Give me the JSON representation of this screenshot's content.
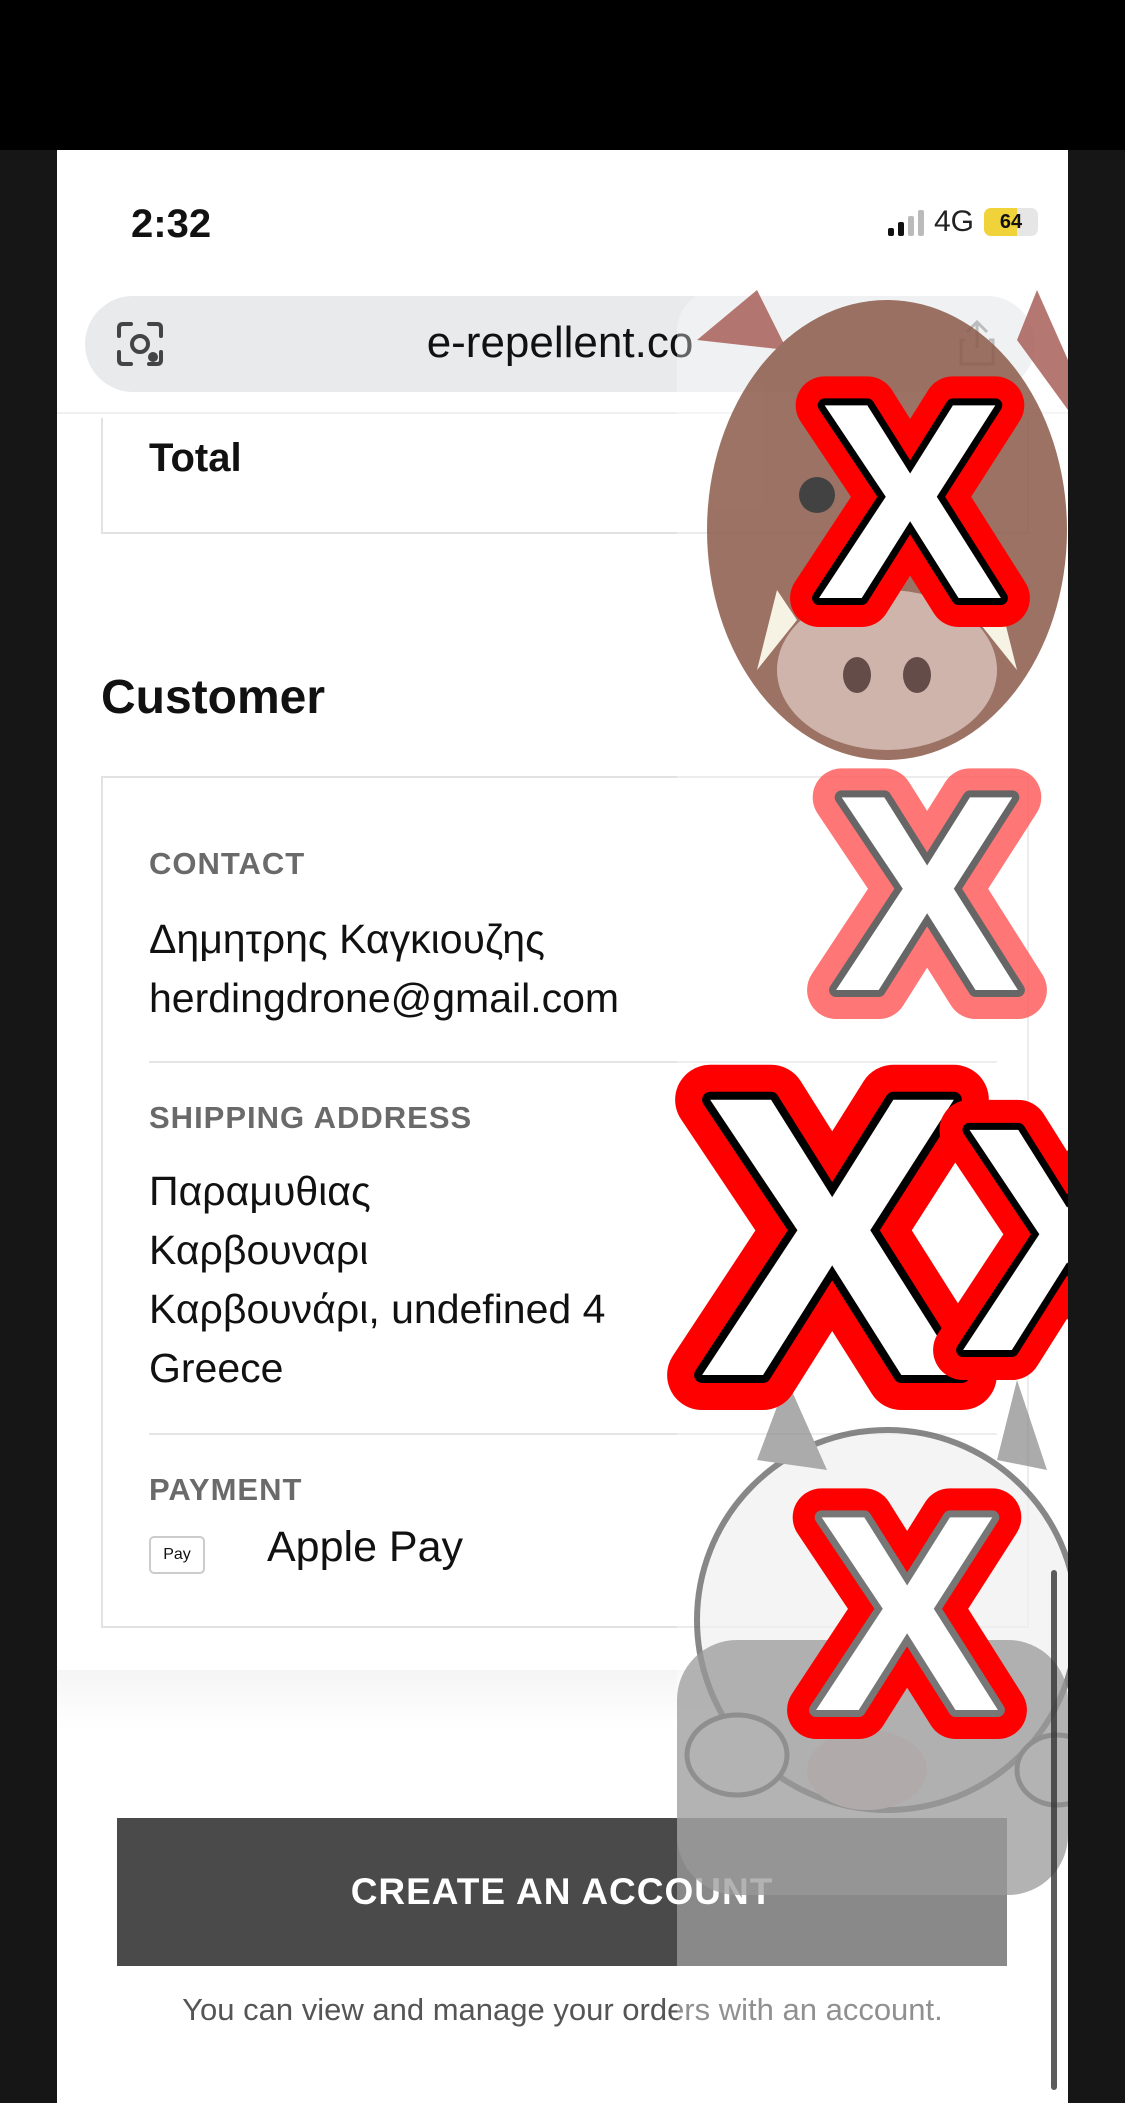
{
  "status_bar": {
    "time": "2:32",
    "network": "4G",
    "battery_level": "64"
  },
  "browser": {
    "url": "e-repellent.co",
    "lens_icon": "camera-lens-icon",
    "share_icon": "share-icon"
  },
  "order_summary": {
    "total_label": "Total"
  },
  "customer": {
    "title": "Customer",
    "contact_label": "CONTACT",
    "contact_name": "Δημητρης Καγκιουζης",
    "contact_email": "herdingdrone@gmail.com",
    "shipping_label": "SHIPPING ADDRESS",
    "address_line1": "Παραμυθιας",
    "address_line2": "Καρβουναρι",
    "address_line3": "Καρβουνάρι, undefined 4",
    "address_country": "Greece",
    "payment_label": "PAYMENT",
    "payment_badge": "Pay",
    "payment_method": "Apple Pay"
  },
  "account": {
    "create_button": "CREATE AN ACCOUNT",
    "help_text": "You can view and manage your orders with an account."
  },
  "overlay": {
    "close_marks": [
      "X",
      "X",
      "X",
      "X",
      "X"
    ],
    "accent_color": "#ff0000"
  }
}
